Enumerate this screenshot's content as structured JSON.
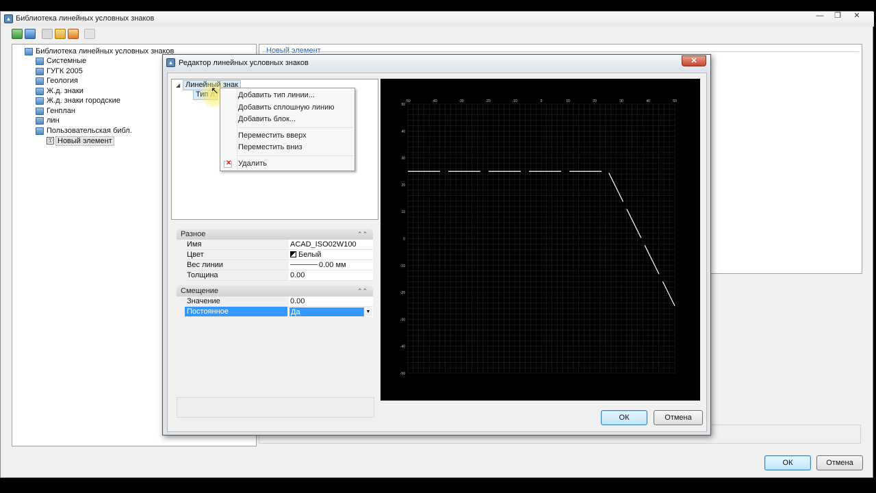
{
  "outer_window": {
    "title": "Библиотека линейных условных знаков",
    "controls": [
      "—",
      "❐",
      "✕"
    ]
  },
  "left_tree": {
    "root": "Библиотека линейных условных знаков",
    "items": [
      {
        "label": "Системные"
      },
      {
        "label": "ГУГК 2005"
      },
      {
        "label": "Геология"
      },
      {
        "label": "Ж.д. знаки"
      },
      {
        "label": "Ж.д. знаки городские"
      },
      {
        "label": "Генплан"
      },
      {
        "label": "лин"
      },
      {
        "label": "Пользовательская библ."
      }
    ],
    "child": "Новый элемент"
  },
  "right_panel": {
    "header": "Новый элемент"
  },
  "outer_buttons": {
    "ok": "ОК",
    "cancel": "Отмена"
  },
  "dialog": {
    "title": "Редактор линейных условных знаков",
    "tree": {
      "root_label": "Линейный знак",
      "child_label": "Тип л"
    },
    "context_menu": {
      "items": [
        {
          "label": "Добавить тип линии..."
        },
        {
          "label": "Добавить сплошную линию"
        },
        {
          "label": "Добавить блок..."
        },
        {
          "label": "Переместить вверх"
        },
        {
          "label": "Переместить вниз"
        },
        {
          "label": "Удалить"
        }
      ]
    },
    "properties": {
      "group1": {
        "title": "Разное",
        "rows": [
          {
            "key": "Имя",
            "value": "ACAD_ISO02W100"
          },
          {
            "key": "Цвет",
            "value": "Белый"
          },
          {
            "key": "Вес линии",
            "value": "0.00 мм"
          },
          {
            "key": "Толщина",
            "value": "0.00"
          }
        ]
      },
      "group2": {
        "title": "Смещение",
        "rows": [
          {
            "key": "Значение",
            "value": "0.00"
          },
          {
            "key": "Постоянное",
            "value": "Да"
          }
        ]
      }
    },
    "preview": {
      "x_ticks": [
        "-50",
        "-40",
        "-30",
        "-20",
        "-10",
        "0",
        "10",
        "20",
        "30",
        "40",
        "50"
      ],
      "y_ticks": [
        "50",
        "40",
        "30",
        "20",
        "10",
        "0",
        "-10",
        "-20",
        "-30",
        "-40",
        "-50"
      ],
      "background": "#000000",
      "line_color": "#ffffff",
      "grid_color": "#2a2a2a"
    },
    "buttons": {
      "ok": "ОК",
      "cancel": "Отмена"
    }
  }
}
